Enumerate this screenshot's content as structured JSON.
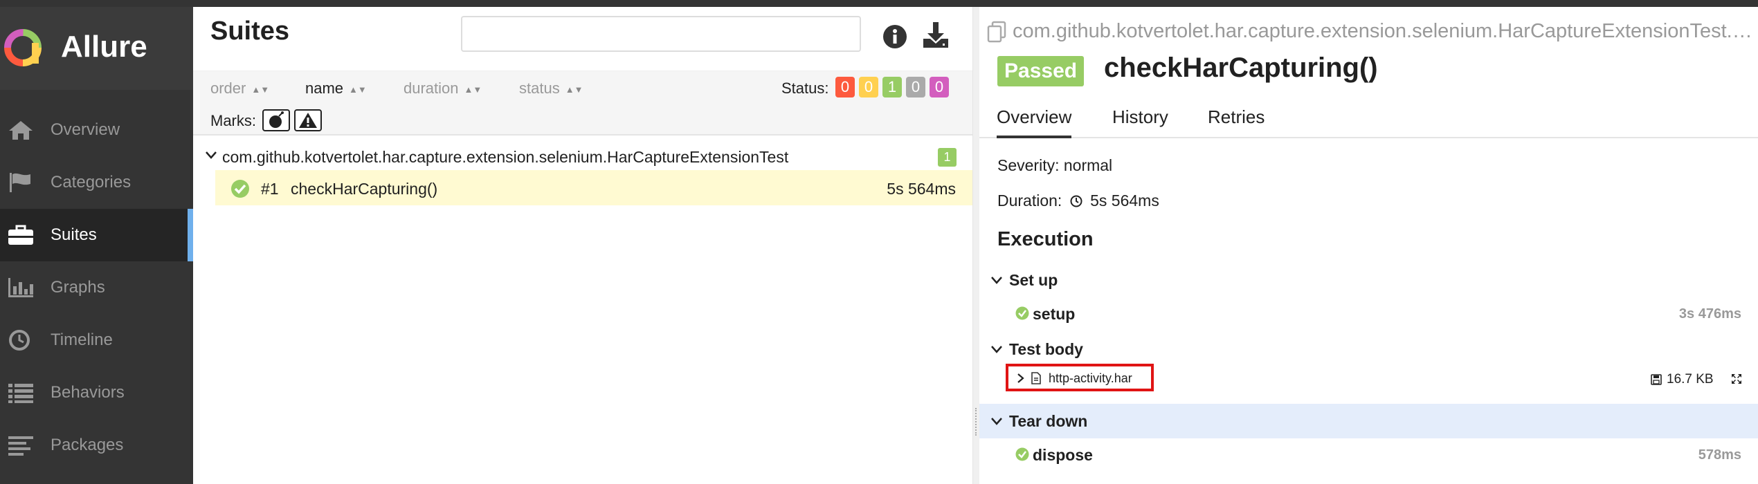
{
  "sidebar": {
    "brand": "Allure",
    "items": [
      {
        "label": "Overview",
        "icon": "home-icon"
      },
      {
        "label": "Categories",
        "icon": "flag-icon"
      },
      {
        "label": "Suites",
        "icon": "briefcase-icon",
        "active": true
      },
      {
        "label": "Graphs",
        "icon": "bar-chart-icon"
      },
      {
        "label": "Timeline",
        "icon": "clock-icon"
      },
      {
        "label": "Behaviors",
        "icon": "list-icon"
      },
      {
        "label": "Packages",
        "icon": "align-left-icon"
      }
    ]
  },
  "suites": {
    "title": "Suites",
    "search_placeholder": "",
    "sort": {
      "order": "order",
      "name": "name",
      "duration": "duration",
      "status": "status"
    },
    "status_label": "Status:",
    "status_counts": [
      {
        "value": "0",
        "color": "#fd5a3e"
      },
      {
        "value": "0",
        "color": "#ffd050"
      },
      {
        "value": "1",
        "color": "#97cc64"
      },
      {
        "value": "0",
        "color": "#aaaaaa"
      },
      {
        "value": "0",
        "color": "#d35ebe"
      }
    ],
    "marks_label": "Marks:",
    "group": {
      "name": "com.github.kotvertolet.har.capture.extension.selenium.HarCaptureExtensionTest",
      "count": "1"
    },
    "test": {
      "number": "#1",
      "name": "checkHarCapturing()",
      "duration": "5s 564ms"
    }
  },
  "detail": {
    "breadcrumb": "com.github.kotvertolet.har.capture.extension.selenium.HarCaptureExtensionTest.checkHarCapturing",
    "status": "Passed",
    "title": "checkHarCapturing()",
    "tabs": [
      "Overview",
      "History",
      "Retries"
    ],
    "severity": "Severity: normal",
    "duration_label": "Duration:",
    "duration_value": "5s 564ms",
    "execution_title": "Execution",
    "setup": {
      "label": "Set up",
      "step": "setup",
      "duration": "3s 476ms"
    },
    "body": {
      "label": "Test body",
      "attachment": "http-activity.har",
      "size": "16.7 KB"
    },
    "teardown": {
      "label": "Tear down",
      "step": "dispose",
      "duration": "578ms"
    }
  },
  "colors": {
    "sidebar_bg": "#343434",
    "accent": "#6fb0ec",
    "passed": "#97cc64",
    "highlight": "#fffad2"
  }
}
